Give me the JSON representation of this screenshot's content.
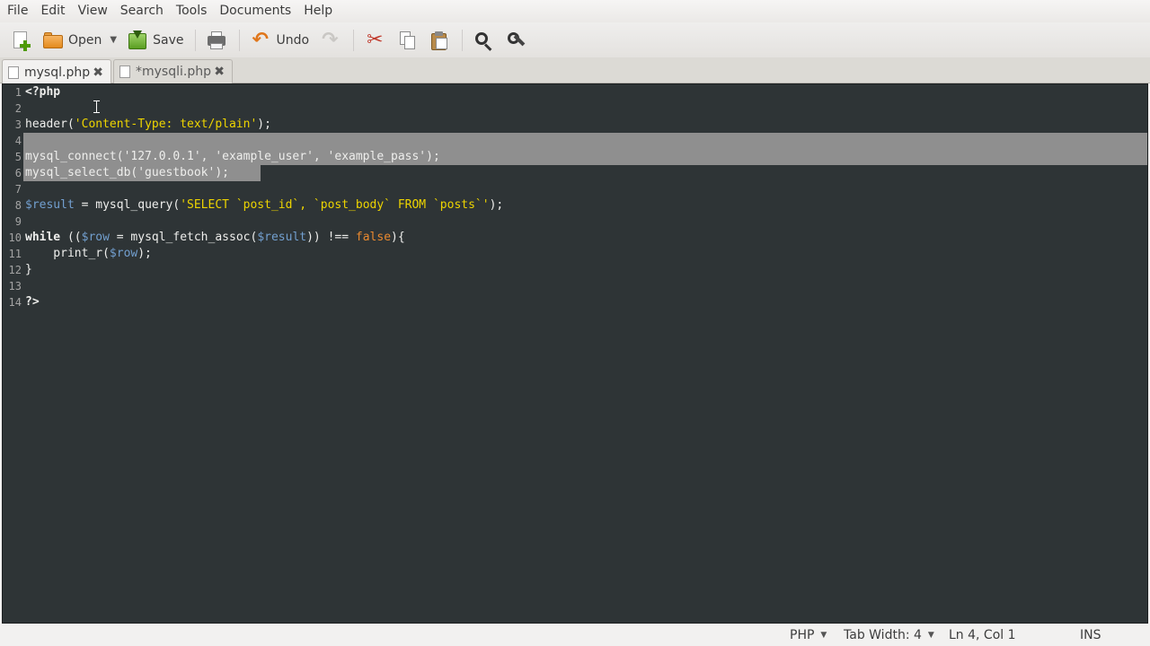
{
  "menu": [
    "File",
    "Edit",
    "View",
    "Search",
    "Tools",
    "Documents",
    "Help"
  ],
  "toolbar": {
    "open_label": "Open",
    "save_label": "Save",
    "undo_label": "Undo",
    "icons": [
      "new-document-icon",
      "open-folder-icon",
      "save-icon",
      "print-icon",
      "undo-arrow-icon",
      "redo-arrow-icon",
      "cut-icon",
      "copy-icon",
      "paste-icon",
      "search-icon",
      "search-replace-icon"
    ]
  },
  "tabs": [
    {
      "label": "mysql.php",
      "active": true
    },
    {
      "label": "*mysqli.php",
      "active": false
    }
  ],
  "editor": {
    "line_numbers": [
      "1",
      "2",
      "3",
      "4",
      "5",
      "6",
      "7",
      "8",
      "9",
      "10",
      "11",
      "12",
      "13",
      "14"
    ],
    "colors": {
      "background": "#2e3436",
      "string": "#edd400",
      "variable": "#729fcf",
      "constant": "#e9892f",
      "selection": "#8f8f8f"
    },
    "lines": {
      "l1": "<?php",
      "l3a": "header(",
      "l3b": "'Content-Type: text/plain'",
      "l3c": ");",
      "l5": "mysql_connect('127.0.0.1', 'example_user', 'example_pass');",
      "l6": "mysql_select_db('guestbook');",
      "l8a": "$result",
      "l8b": " = mysql_query(",
      "l8c": "'SELECT `post_id`, `post_body` FROM `posts`'",
      "l8d": ");",
      "l10a": "while",
      "l10b": " ((",
      "l10c": "$row",
      "l10d": " = mysql_fetch_assoc(",
      "l10e": "$result",
      "l10f": ")) !== ",
      "l10g": "false",
      "l10h": "){",
      "l11a": "    print_r(",
      "l11b": "$row",
      "l11c": ");",
      "l12": "}",
      "l14": "?>"
    }
  },
  "status": {
    "language": "PHP",
    "tab_width": "Tab Width: 4",
    "position": "Ln 4, Col 1",
    "mode": "INS"
  }
}
